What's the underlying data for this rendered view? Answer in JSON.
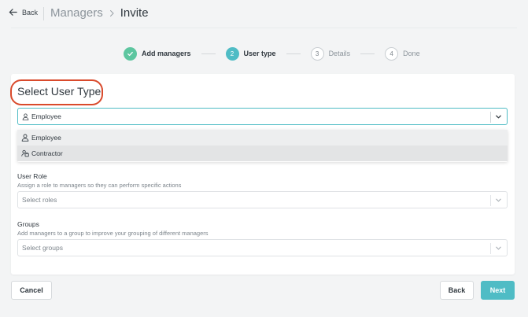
{
  "header": {
    "back_label": "Back",
    "breadcrumb_parent": "Managers",
    "breadcrumb_current": "Invite"
  },
  "stepper": {
    "steps": [
      {
        "number": "",
        "label": "Add managers",
        "state": "done"
      },
      {
        "number": "2",
        "label": "User type",
        "state": "active"
      },
      {
        "number": "3",
        "label": "Details",
        "state": "pending"
      },
      {
        "number": "4",
        "label": "Done",
        "state": "pending"
      }
    ]
  },
  "card": {
    "title": "Select User Type",
    "user_type": {
      "selected": "Employee",
      "options": [
        "Employee",
        "Contractor"
      ]
    },
    "user_role": {
      "label": "User Role",
      "help": "Assign a role to managers so they can perform specific actions",
      "placeholder": "Select roles"
    },
    "groups": {
      "label": "Groups",
      "help": "Add managers to a group to improve your grouping of different managers",
      "placeholder": "Select groups"
    }
  },
  "footer": {
    "cancel_label": "Cancel",
    "back_label": "Back",
    "next_label": "Next"
  },
  "colors": {
    "accent": "#4fbcc5",
    "done": "#5dc6a0",
    "highlight": "#d94a2c"
  }
}
